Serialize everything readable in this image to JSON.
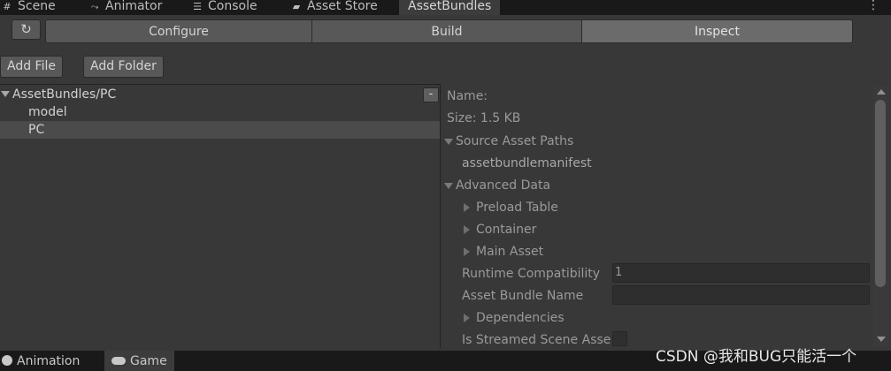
{
  "tabs": [
    {
      "label": "Scene",
      "icon": "grid-icon"
    },
    {
      "label": "Animator",
      "icon": "animator-icon"
    },
    {
      "label": "Console",
      "icon": "console-icon"
    },
    {
      "label": "Asset Store",
      "icon": "shopping-bag-icon"
    },
    {
      "label": "AssetBundles",
      "icon": ""
    }
  ],
  "window_menu": "⋮",
  "toolbar": {
    "refresh_icon": "refresh-icon",
    "segments": [
      "Configure",
      "Build",
      "Inspect"
    ],
    "selected_segment": "Inspect",
    "add_file": "Add File",
    "add_folder": "Add Folder"
  },
  "tree": {
    "root": "AssetBundles/PC",
    "collapse_label": "-",
    "items": [
      "model",
      "PC"
    ],
    "selected": "PC"
  },
  "inspector": {
    "name_label": "Name:",
    "size_label": "Size: 1.5 KB",
    "source_asset_paths": "Source Asset Paths",
    "source_path_value": "assetbundlemanifest",
    "advanced_data": "Advanced Data",
    "preload_table": "Preload Table",
    "container": "Container",
    "main_asset": "Main Asset",
    "runtime_compat_label": "Runtime Compatibility",
    "runtime_compat_value": "1",
    "bundle_name_label": "Asset Bundle Name",
    "bundle_name_value": "",
    "dependencies": "Dependencies",
    "is_streamed_label": "Is Streamed Scene Asse"
  },
  "bottom_tabs": [
    {
      "label": "Animation",
      "icon": "clock-icon"
    },
    {
      "label": "Game",
      "icon": "gamepad-icon"
    }
  ],
  "watermark": "CSDN @我和BUG只能活一个"
}
